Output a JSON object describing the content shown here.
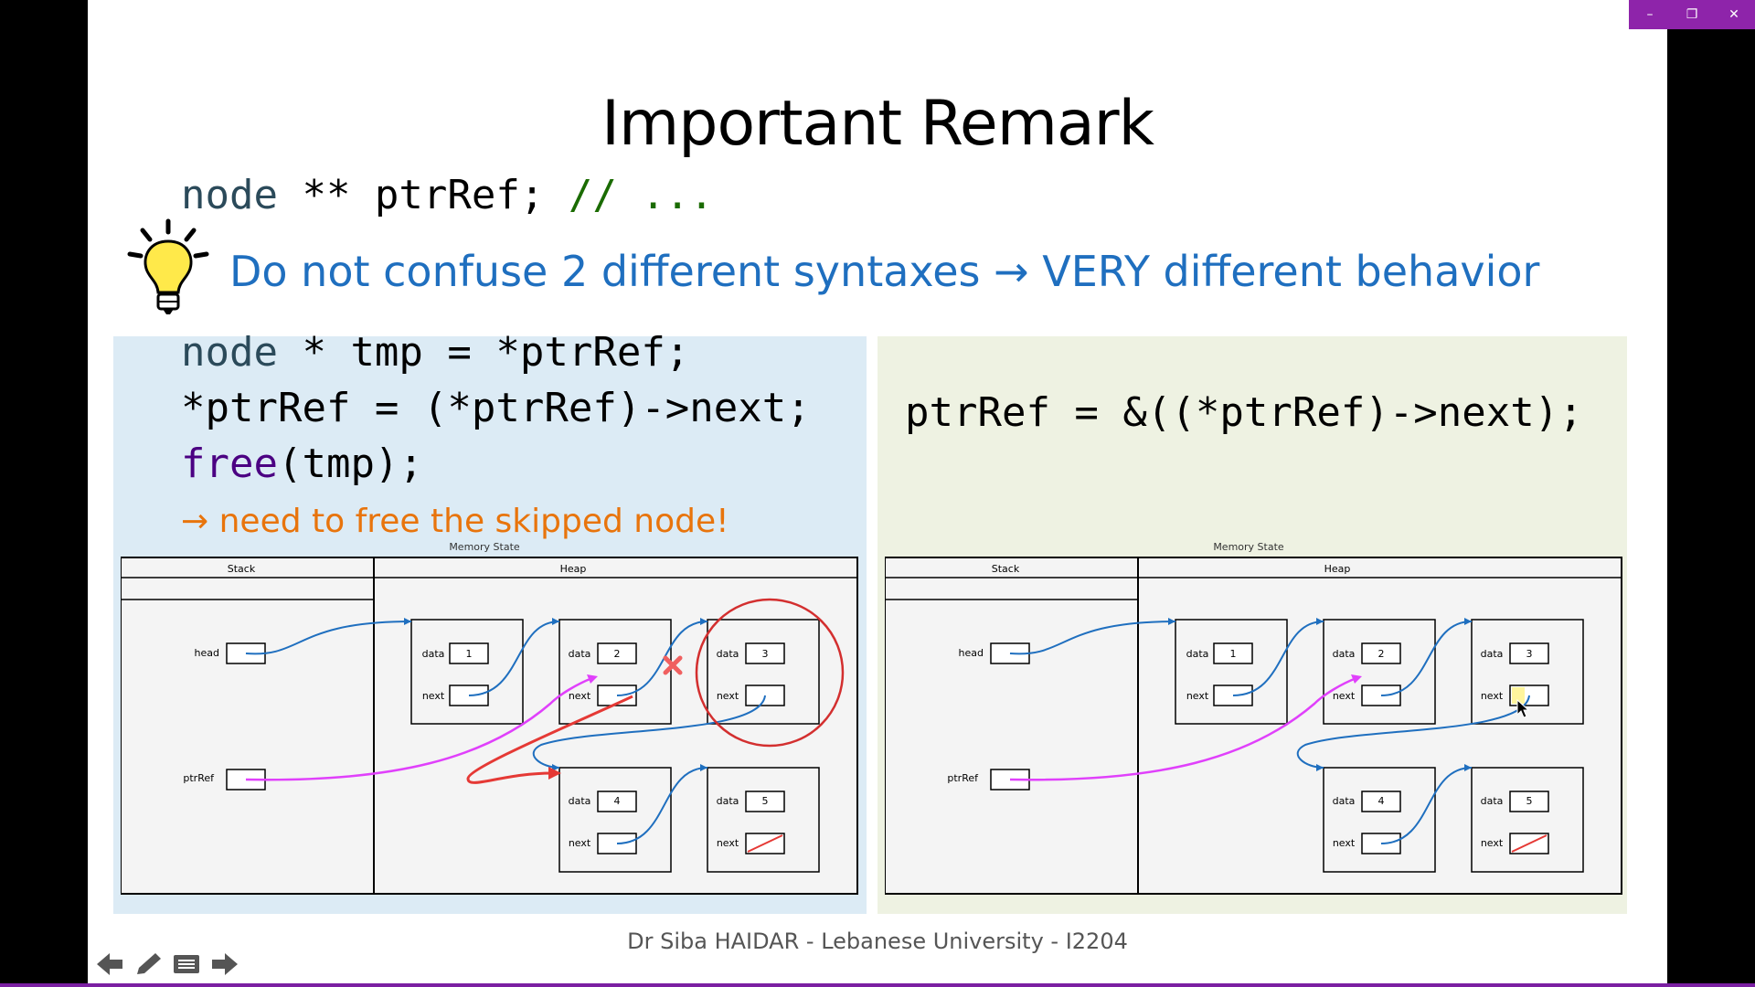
{
  "slide": {
    "title": "Important Remark",
    "declaration": {
      "type": "node",
      "rest": " ** ptrRef; ",
      "comment": "// ..."
    },
    "remark": "Do not confuse 2 different syntaxes → VERY different behavior",
    "left": {
      "line1_type": "node",
      "line1_rest": " * tmp = *ptrRef;",
      "line2": "*ptrRef = (*ptrRef)->next;",
      "line3_fn": "free",
      "line3_rest": "(tmp);",
      "note": "→ need to free the skipped node!"
    },
    "right": {
      "line1": "ptrRef = &((*ptrRef)->next);"
    },
    "diagram": {
      "caption": "Memory State",
      "stack_label": "Stack",
      "heap_label": "Heap",
      "head_label": "head",
      "ptrref_label": "ptrRef",
      "data_label": "data",
      "next_label": "next",
      "nodes": [
        "1",
        "2",
        "3",
        "4",
        "5"
      ]
    },
    "footer": "Dr Siba HAIDAR - Lebanese University - I2204"
  },
  "colors": {
    "remark": "#1f6fbf",
    "note": "#e8740c",
    "comment": "#1a6b00",
    "window_bar": "#8e24aa"
  },
  "icons": [
    "lightbulb-icon",
    "minimize-icon",
    "restore-icon",
    "close-icon",
    "arrow-left-icon",
    "pen-icon",
    "menu-icon",
    "arrow-right-icon"
  ]
}
